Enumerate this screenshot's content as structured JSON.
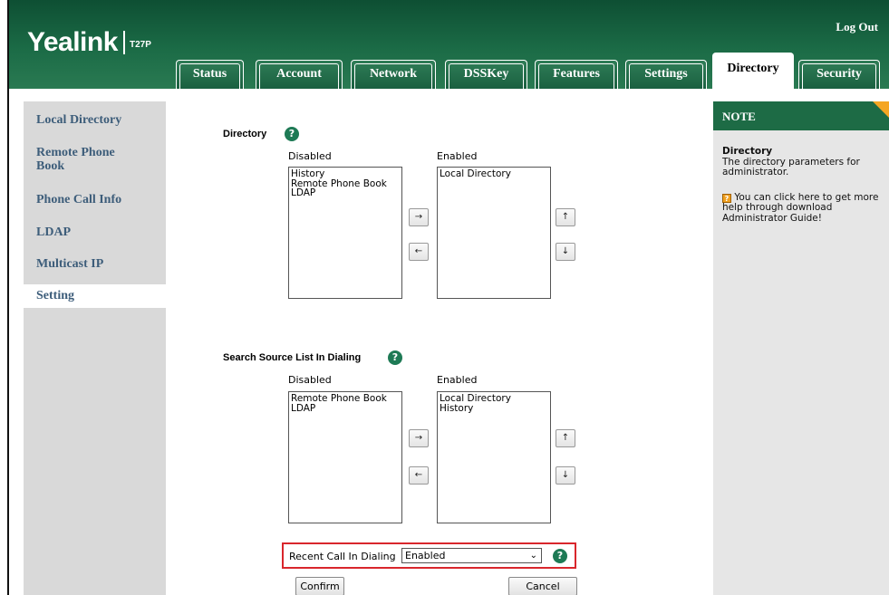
{
  "header": {
    "logo": "Yealink",
    "model": "T27P",
    "logout": "Log Out",
    "tabs": [
      "Status",
      "Account",
      "Network",
      "DSSKey",
      "Features",
      "Settings",
      "Directory",
      "Security"
    ],
    "active_tab": "Directory"
  },
  "sidebar": {
    "items": [
      "Local Directory",
      "Remote Phone Book",
      "Phone Call Info",
      "LDAP",
      "Multicast IP",
      "Setting"
    ],
    "active": "Setting"
  },
  "directory": {
    "title": "Directory",
    "disabled_label": "Disabled",
    "enabled_label": "Enabled",
    "disabled_items": [
      "History",
      "Remote Phone Book",
      "LDAP"
    ],
    "enabled_items": [
      "Local Directory"
    ]
  },
  "search_source": {
    "title": "Search Source List In Dialing",
    "disabled_label": "Disabled",
    "enabled_label": "Enabled",
    "disabled_items": [
      "Remote Phone Book",
      "LDAP"
    ],
    "enabled_items": [
      "Local Directory",
      "History"
    ]
  },
  "buttons": {
    "move_right": "→",
    "move_left": "←",
    "move_up": "↑",
    "move_down": "↓",
    "confirm": "Confirm",
    "cancel": "Cancel"
  },
  "recent_call": {
    "label": "Recent Call In Dialing",
    "value": "Enabled"
  },
  "note": {
    "title": "NOTE",
    "heading": "Directory",
    "text": "The directory parameters for administrator.",
    "help": "You can click here to get more help through download Administrator Guide!"
  },
  "colors": {
    "header_green": "#1b6b46",
    "link_blue": "#3d5d7a",
    "highlight_red": "#d9262c"
  }
}
